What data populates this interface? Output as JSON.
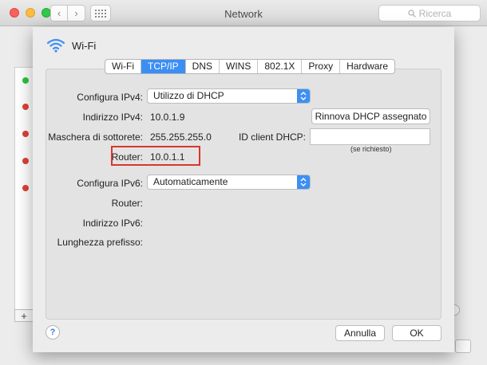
{
  "window": {
    "title": "Network",
    "search_placeholder": "Ricerca"
  },
  "sheet": {
    "interface_name": "Wi-Fi",
    "tabs": [
      {
        "label": "Wi-Fi"
      },
      {
        "label": "TCP/IP"
      },
      {
        "label": "DNS"
      },
      {
        "label": "WINS"
      },
      {
        "label": "802.1X"
      },
      {
        "label": "Proxy"
      },
      {
        "label": "Hardware"
      }
    ],
    "active_tab": "TCP/IP",
    "ipv4": {
      "config_label": "Configura IPv4:",
      "config_value": "Utilizzo di DHCP",
      "address_label": "Indirizzo IPv4:",
      "address_value": "10.0.1.9",
      "mask_label": "Maschera di sottorete:",
      "mask_value": "255.255.255.0",
      "router_label": "Router:",
      "router_value": "10.0.1.1",
      "renew_button": "Rinnova DHCP assegnato",
      "client_id_label": "ID client DHCP:",
      "client_id_value": "",
      "client_id_hint": "(se richiesto)"
    },
    "ipv6": {
      "config_label": "Configura IPv6:",
      "config_value": "Automaticamente",
      "router_label": "Router:",
      "address_label": "Indirizzo IPv6:",
      "prefix_label": "Lunghezza prefisso:"
    },
    "footer": {
      "help": "?",
      "cancel": "Annulla",
      "ok": "OK"
    }
  },
  "sidebar": {
    "add_label": "+"
  },
  "colors": {
    "accent": "#3b8ef4",
    "highlight": "#d9362b",
    "status_green": "#29c43f",
    "status_red": "#e0403a"
  },
  "background_status_dots": [
    "green",
    "red",
    "red",
    "red",
    "red"
  ]
}
